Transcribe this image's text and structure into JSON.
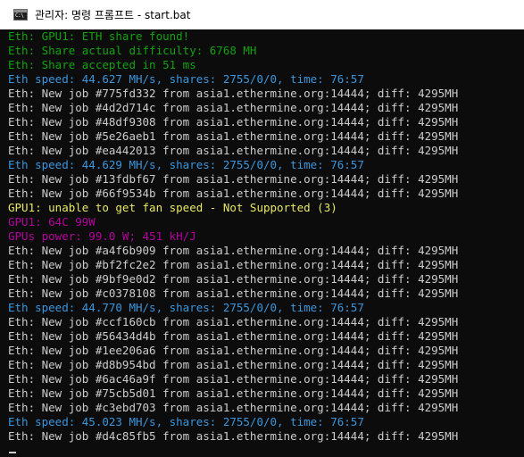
{
  "window": {
    "title": "관리자: 명령 프롬프트 - start.bat",
    "icon": "cmd-icon",
    "icon_glyph": "C:\\"
  },
  "colors": {
    "green": "#13a10e",
    "cyan": "#3a96dd",
    "white": "#cccccc",
    "yellow": "#e8e864",
    "magenta": "#b4009e"
  },
  "console": {
    "lines": [
      {
        "text": "Eth: GPU1: ETH share found!",
        "color": "green"
      },
      {
        "text": "Eth: Share actual difficulty: 6768 MH",
        "color": "green"
      },
      {
        "text": "Eth: Share accepted in 51 ms",
        "color": "green"
      },
      {
        "text": "Eth speed: 44.627 MH/s, shares: 2755/0/0, time: 76:57",
        "color": "cyan"
      },
      {
        "text": "Eth: New job #775fd332 from asia1.ethermine.org:14444; diff: 4295MH",
        "color": "white"
      },
      {
        "text": "Eth: New job #4d2d714c from asia1.ethermine.org:14444; diff: 4295MH",
        "color": "white"
      },
      {
        "text": "Eth: New job #48df9308 from asia1.ethermine.org:14444; diff: 4295MH",
        "color": "white"
      },
      {
        "text": "Eth: New job #5e26aeb1 from asia1.ethermine.org:14444; diff: 4295MH",
        "color": "white"
      },
      {
        "text": "Eth: New job #ea442013 from asia1.ethermine.org:14444; diff: 4295MH",
        "color": "white"
      },
      {
        "text": "Eth speed: 44.629 MH/s, shares: 2755/0/0, time: 76:57",
        "color": "cyan"
      },
      {
        "text": "Eth: New job #13fdbf67 from asia1.ethermine.org:14444; diff: 4295MH",
        "color": "white"
      },
      {
        "text": "Eth: New job #66f9534b from asia1.ethermine.org:14444; diff: 4295MH",
        "color": "white"
      },
      {
        "text": "GPU1: unable to get fan speed - Not Supported (3)",
        "color": "yellow"
      },
      {
        "text": "GPU1: 64C 99W",
        "color": "magenta"
      },
      {
        "text": "GPUs power: 99.0 W; 451 kH/J",
        "color": "magenta"
      },
      {
        "text": "Eth: New job #a4f6b909 from asia1.ethermine.org:14444; diff: 4295MH",
        "color": "white"
      },
      {
        "text": "Eth: New job #bf2fc2e2 from asia1.ethermine.org:14444; diff: 4295MH",
        "color": "white"
      },
      {
        "text": "Eth: New job #9bf9e0d2 from asia1.ethermine.org:14444; diff: 4295MH",
        "color": "white"
      },
      {
        "text": "Eth: New job #c0378108 from asia1.ethermine.org:14444; diff: 4295MH",
        "color": "white"
      },
      {
        "text": "Eth speed: 44.770 MH/s, shares: 2755/0/0, time: 76:57",
        "color": "cyan"
      },
      {
        "text": "Eth: New job #ccf160cb from asia1.ethermine.org:14444; diff: 4295MH",
        "color": "white"
      },
      {
        "text": "Eth: New job #56434d4b from asia1.ethermine.org:14444; diff: 4295MH",
        "color": "white"
      },
      {
        "text": "Eth: New job #1ee206a6 from asia1.ethermine.org:14444; diff: 4295MH",
        "color": "white"
      },
      {
        "text": "Eth: New job #d8b954bd from asia1.ethermine.org:14444; diff: 4295MH",
        "color": "white"
      },
      {
        "text": "Eth: New job #6ac46a9f from asia1.ethermine.org:14444; diff: 4295MH",
        "color": "white"
      },
      {
        "text": "Eth: New job #75cb5d01 from asia1.ethermine.org:14444; diff: 4295MH",
        "color": "white"
      },
      {
        "text": "Eth: New job #c3ebd703 from asia1.ethermine.org:14444; diff: 4295MH",
        "color": "white"
      },
      {
        "text": "Eth speed: 45.023 MH/s, shares: 2755/0/0, time: 76:57",
        "color": "cyan"
      },
      {
        "text": "Eth: New job #d4c85fb5 from asia1.ethermine.org:14444; diff: 4295MH",
        "color": "white"
      }
    ]
  }
}
